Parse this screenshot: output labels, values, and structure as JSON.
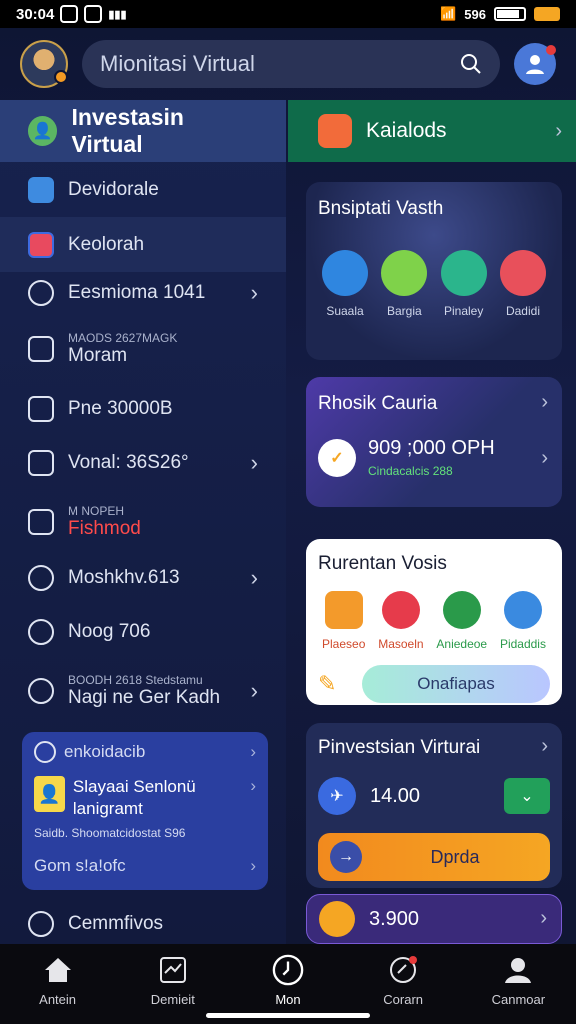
{
  "status_bar": {
    "time": "30:04",
    "right_text": "596"
  },
  "header": {
    "search_text": "Mionitasi Virtual"
  },
  "sidebar": {
    "title": "Investasin Virtual",
    "items": [
      {
        "label": "Devidorale"
      },
      {
        "label": "Keolorah"
      },
      {
        "label": "Eesmioma 1041"
      },
      {
        "sub": "MAODS 2627MAGK",
        "label": "Moram"
      },
      {
        "label": "Pne 30000B"
      },
      {
        "label": "Vonal: 36S26°"
      },
      {
        "sub": "M NOPEH",
        "label": "Fishmod"
      },
      {
        "label": "Moshkhv.613"
      },
      {
        "label": "Noog 706"
      },
      {
        "sub": "BOODH 2618 Stedstamu",
        "label": "Nagi ne Ger Kadh"
      }
    ],
    "promo": {
      "top": "enkoidacib",
      "title": "Slayaai Senlonü lanigramt",
      "sub": "Saidb. Shoomatcidostat S96",
      "bottom": "Gom s!a!ofc"
    },
    "footer": "Cemmfivos"
  },
  "right": {
    "top_card": "Kaialods",
    "card1": {
      "title": "Bnsiptati Vasth",
      "icons": [
        "Suaala",
        "Bargia",
        "Pinaley",
        "Dadidi"
      ]
    },
    "card2": {
      "title": "Rhosik Cauria",
      "amount": "909 ;000 OPH",
      "sub": "Cindacalcis 288"
    },
    "card3": {
      "title": "Rurentan Vosis",
      "icons": [
        "Plaeseo",
        "Masoeln",
        "Aniedeoe",
        "Pidaddis"
      ],
      "button": "Onafiapas"
    },
    "card4": {
      "title": "Pinvestsian Virturai",
      "value": "14.00",
      "button": "Dprda"
    },
    "card5": {
      "value": "3.900"
    }
  },
  "bottom_nav": [
    "Antein",
    "Demieit",
    "Mon",
    "Corarn",
    "Canmoar"
  ]
}
